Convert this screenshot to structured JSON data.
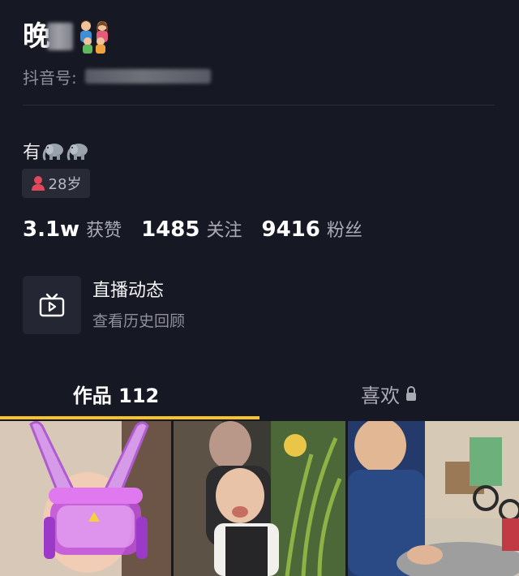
{
  "profile": {
    "name": "晚",
    "id_label": "抖音号:",
    "bio": "有",
    "age_tag": "28岁"
  },
  "stats": [
    {
      "value": "3.1w",
      "label": "获赞"
    },
    {
      "value": "1485",
      "label": "关注"
    },
    {
      "value": "9416",
      "label": "粉丝"
    }
  ],
  "live": {
    "title": "直播动态",
    "subtitle": "查看历史回顾"
  },
  "tabs": {
    "works_label": "作品 112",
    "likes_label": "喜欢"
  },
  "icons": {
    "family": "family-emoji-icon",
    "elephant": "elephant-emoji-icon",
    "age": "person-icon",
    "live": "tv-play-icon",
    "lock": "lock-icon"
  },
  "colors": {
    "background": "#161824",
    "tab_indicator": "#f7c22b",
    "secondary_text": "#8e8f99",
    "age_icon": "#e0485c"
  }
}
